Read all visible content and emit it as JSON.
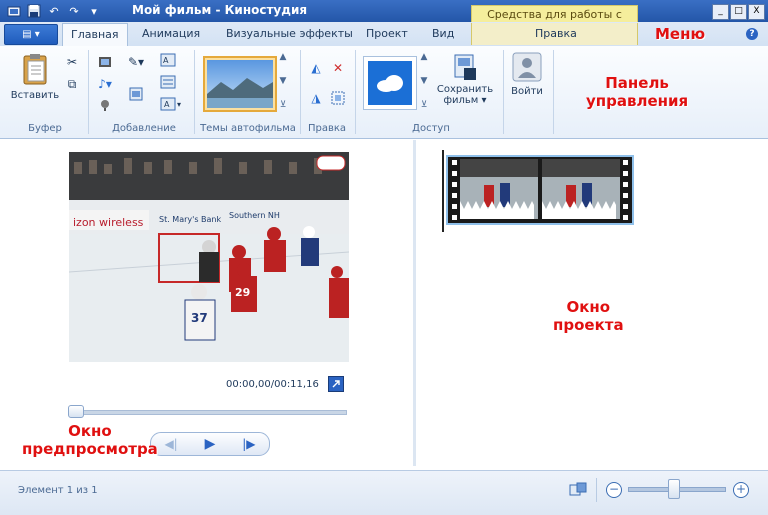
{
  "window": {
    "title": "Мой фильм - Киностудия",
    "contextual_tools_label": "Средства для работы с видео",
    "minimize": "_",
    "maximize": "□",
    "close": "X"
  },
  "tabs": [
    {
      "label": "Главная",
      "active": true
    },
    {
      "label": "Анимация"
    },
    {
      "label": "Визуальные эффекты"
    },
    {
      "label": "Проект"
    },
    {
      "label": "Вид"
    },
    {
      "label": "Правка"
    }
  ],
  "ribbon": {
    "paste_label": "Вставить",
    "save_movie_label": "Сохранить\nфильм ▾",
    "signin_label": "Войти",
    "groups": [
      "Буфер",
      "Добавление",
      "Темы автофильма",
      "Правка",
      "Доступ"
    ]
  },
  "preview": {
    "time": "00:00,00/00:11,16",
    "progress": 0.0
  },
  "annotations": {
    "menu": "Меню",
    "control_panel_1": "Панель",
    "control_panel_2": "управления",
    "project_window_1": "Окно",
    "project_window_2": "проекта",
    "preview_window_1": "Окно",
    "preview_window_2": "предпросмотра"
  },
  "status": {
    "element_count": "Элемент 1 из 1",
    "zoom_level": 0.45
  }
}
